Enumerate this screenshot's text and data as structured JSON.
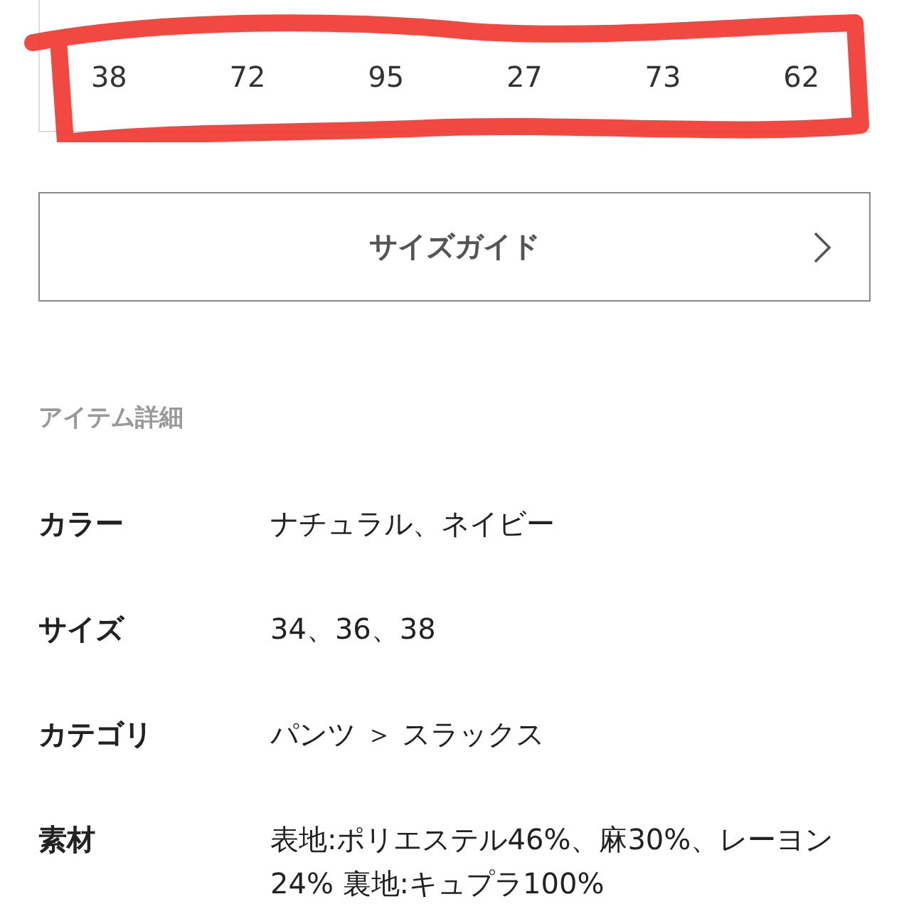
{
  "size_table": {
    "cells": [
      "38",
      "72",
      "95",
      "27",
      "73",
      "62"
    ]
  },
  "size_guide_button": {
    "label": "サイズガイド"
  },
  "item_details": {
    "heading": "アイテム詳細",
    "rows": [
      {
        "label": "カラー",
        "value": "ナチュラル、ネイビー"
      },
      {
        "label": "サイズ",
        "value": "34、36、38"
      },
      {
        "label": "カテゴリ",
        "value": "パンツ ＞ スラックス"
      },
      {
        "label": "素材",
        "value": "表地:ポリエステル46%、麻30%、レーヨン24% 裏地:キュプラ100%"
      }
    ]
  }
}
